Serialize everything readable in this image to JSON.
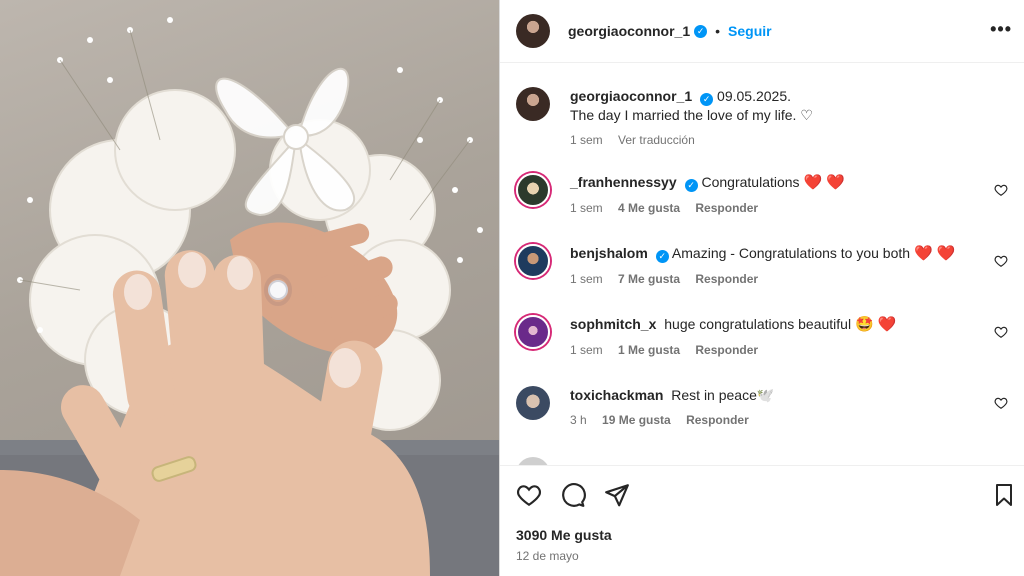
{
  "post": {
    "photo_icon": "wedding-rings-hands-photo",
    "author": {
      "username": "georgiaoconnor_1",
      "verified": true,
      "follow_label": "Seguir",
      "separator": "•",
      "more_icon": "more-horizontal-icon",
      "more_label": "•••"
    },
    "caption": {
      "username": "georgiaoconnor_1",
      "date_text": "09.05.2025.",
      "text": "The day I married the love of my life. ♡",
      "age": "1 sem",
      "translate_label": "Ver traducción"
    },
    "comments": [
      {
        "username": "_franhennessyy",
        "verified": true,
        "text": "Congratulations",
        "emoji": "❤️ ❤️",
        "age": "1 sem",
        "likes": "4 Me gusta",
        "reply_label": "Responder"
      },
      {
        "username": "benjshalom",
        "verified": true,
        "text": "Amazing - Congratulations to you both",
        "emoji": "❤️ ❤️",
        "age": "1 sem",
        "likes": "7 Me gusta",
        "reply_label": "Responder"
      },
      {
        "username": "sophmitch_x",
        "verified": false,
        "text": "huge congratulations beautiful",
        "emoji": "🤩 ❤️",
        "age": "1 sem",
        "likes": "1 Me gusta",
        "reply_label": "Responder"
      },
      {
        "username": "toxichackman",
        "verified": false,
        "text": "Rest in peace🕊️",
        "emoji": "",
        "age": "3 h",
        "likes": "19 Me gusta",
        "reply_label": "Responder"
      }
    ],
    "actions": {
      "like_icon": "heart-icon",
      "comment_icon": "comment-icon",
      "share_icon": "share-icon",
      "save_icon": "bookmark-icon"
    },
    "likes_total": "3090 Me gusta",
    "posted_date": "12 de mayo"
  },
  "colors": {
    "accent": "#0095f6",
    "text": "#262626",
    "muted": "#737373",
    "heart": "#ed1c24"
  }
}
